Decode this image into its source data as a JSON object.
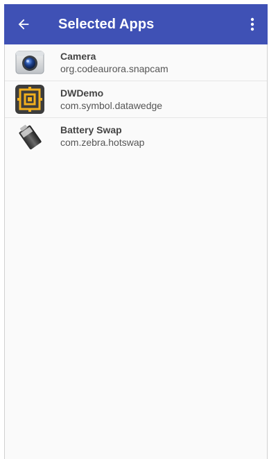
{
  "appbar": {
    "title": "Selected Apps",
    "back_icon": "arrow-left-icon",
    "menu_icon": "more-vert-icon",
    "background": "#3f51b5"
  },
  "apps": [
    {
      "name": "Camera",
      "package": "org.codeaurora.snapcam",
      "icon": "camera-icon"
    },
    {
      "name": "DWDemo",
      "package": "com.symbol.datawedge",
      "icon": "datawedge-icon"
    },
    {
      "name": "Battery Swap",
      "package": "com.zebra.hotswap",
      "icon": "battery-icon"
    }
  ]
}
